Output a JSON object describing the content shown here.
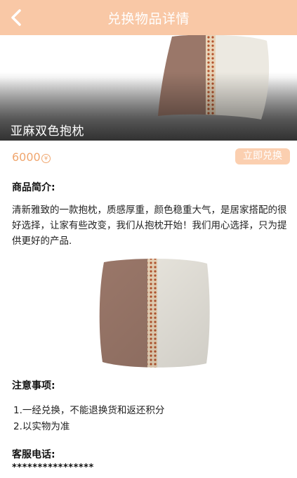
{
  "header": {
    "title": "兑换物品详情",
    "bg_color": "#f9c8a6"
  },
  "icons": {
    "back": "chevron-left-icon",
    "currency": "yen-icon"
  },
  "product": {
    "name": "亚麻双色抱枕",
    "price": "6000",
    "currency_symbol": "¥",
    "redeem_label": "立即兑换",
    "accent_color": "#f0a66e"
  },
  "intro": {
    "title": "商品简介:",
    "text": "清新雅致的一款抱枕，质感厚重，颜色稳重大气，是居家搭配的很好选择，让家有些改变，我们从抱枕开始！我们用心选择，只为提供更好的产品."
  },
  "notes": {
    "title": "注意事项:",
    "items": [
      "1.一经兑换，不能退换货和返还积分",
      "2.以实物为准"
    ]
  },
  "service": {
    "title": "客服电话:",
    "phone": "****************"
  }
}
